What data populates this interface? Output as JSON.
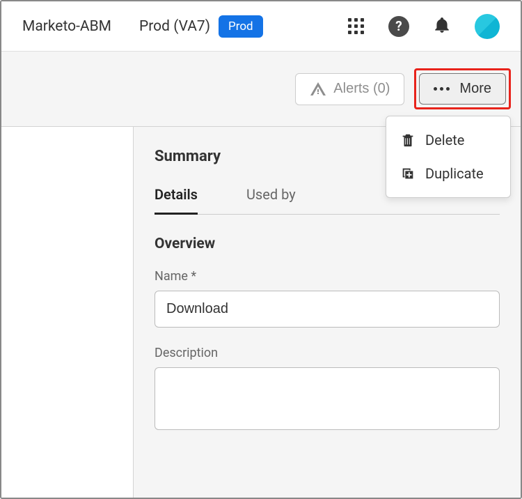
{
  "header": {
    "brand": "Marketo-ABM",
    "env_text": "Prod (VA7)",
    "env_badge": "Prod"
  },
  "subheader": {
    "alerts_label": "Alerts (0)",
    "more_label": "More"
  },
  "dropdown": {
    "delete_label": "Delete",
    "duplicate_label": "Duplicate"
  },
  "content": {
    "summary_title": "Summary",
    "tabs": {
      "details": "Details",
      "used_by": "Used by"
    },
    "overview_title": "Overview",
    "name_label": "Name *",
    "name_value": "Download",
    "description_label": "Description",
    "description_value": ""
  }
}
